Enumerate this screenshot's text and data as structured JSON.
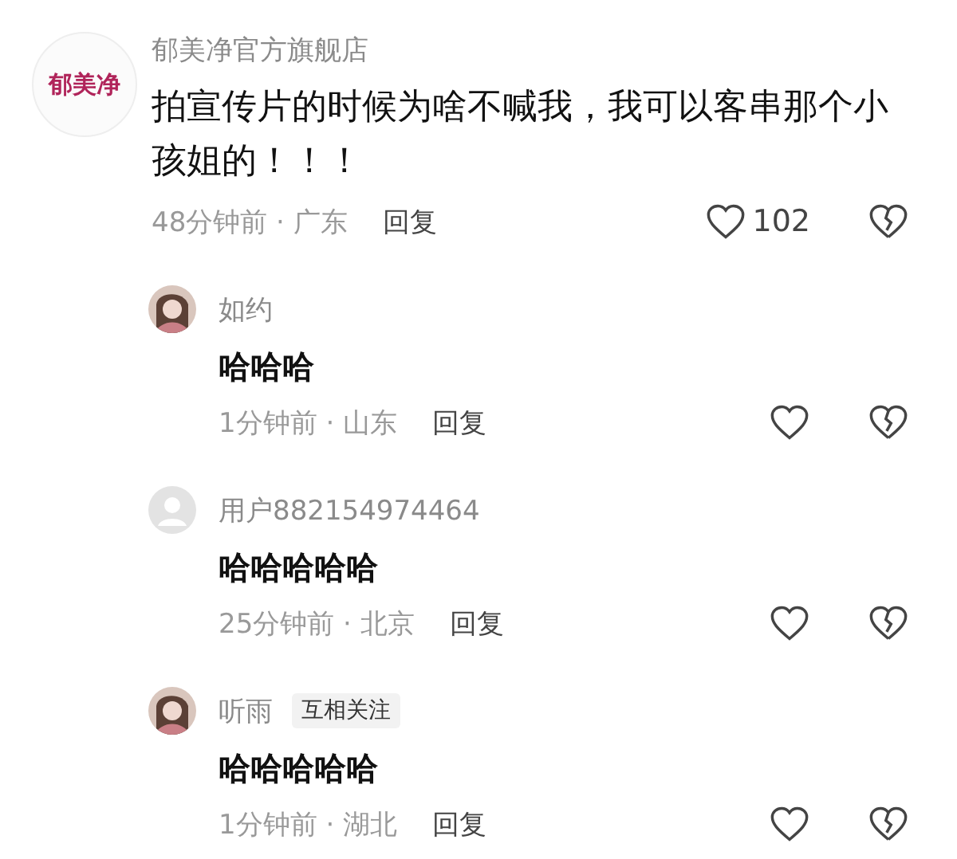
{
  "comment": {
    "avatar_text": "郁美净",
    "author": "郁美净官方旗舰店",
    "text": "拍宣传片的时候为啥不喊我，我可以客串那个小孩姐的！！！",
    "meta": "48分钟前 · 广东",
    "reply": "回复",
    "likes": "102"
  },
  "replies": [
    {
      "author": "如约",
      "text": "哈哈哈",
      "meta": "1分钟前 · 山东",
      "reply": "回复"
    },
    {
      "kind": "default",
      "author": "用户882154974464",
      "text": "哈哈哈哈哈",
      "meta": "25分钟前 · 北京",
      "reply": "回复"
    },
    {
      "author": "听雨",
      "tag": "互相关注",
      "text": "哈哈哈哈哈",
      "meta": "1分钟前 · 湖北",
      "reply": "回复"
    }
  ]
}
